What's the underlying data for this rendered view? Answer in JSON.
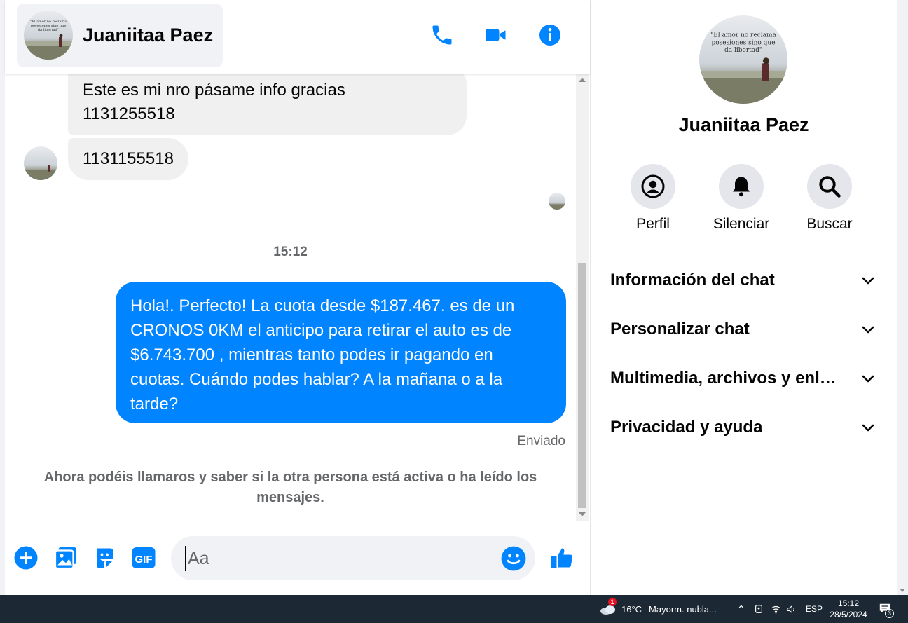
{
  "header": {
    "contact_name": "Juaniitaa Paez"
  },
  "messages": {
    "incoming": [
      {
        "text_line1": "Este es mi nro pásame info gracias",
        "text_line2": "1131255518"
      },
      {
        "text": "1131155518"
      }
    ],
    "time_separator": "15:12",
    "outgoing": {
      "lines": [
        "Hola!. Perfecto! La cuota desde $187.467. es de un",
        "CRONOS 0KM el anticipo para retirar el auto es de",
        "$6.743.700 , mientras tanto podes ir pagando en",
        "cuotas. Cuándo podes hablar? A la mañana o a la",
        "tarde?"
      ],
      "status": "Enviado"
    },
    "notice_line1": "Ahora podéis llamaros y saber si la otra persona está activa o ha leído los",
    "notice_line2": "mensajes."
  },
  "composer": {
    "placeholder": "Aa"
  },
  "sidebar": {
    "name": "Juaniitaa Paez",
    "actions": [
      {
        "label": "Perfil",
        "icon": "profile-icon"
      },
      {
        "label": "Silenciar",
        "icon": "bell-icon"
      },
      {
        "label": "Buscar",
        "icon": "search-icon"
      }
    ],
    "sections": [
      {
        "label": "Información del chat"
      },
      {
        "label": "Personalizar chat"
      },
      {
        "label": "Multimedia, archivos y enlaces"
      },
      {
        "label": "Privacidad y ayuda"
      }
    ]
  },
  "avatar_quote": {
    "line1": "\"El amor no reclama",
    "line2": "posesiones sino que",
    "line3": "da libertad\""
  },
  "taskbar": {
    "weather_badge": "1",
    "temperature": "16°C",
    "weather_text": "Mayorm. nubla...",
    "language": "ESP",
    "time": "15:12",
    "date": "28/5/2024",
    "notifications": "3"
  },
  "colors": {
    "accent": "#0084ff",
    "incoming_bubble": "#f0f0f0",
    "taskbar": "#1c2833"
  }
}
